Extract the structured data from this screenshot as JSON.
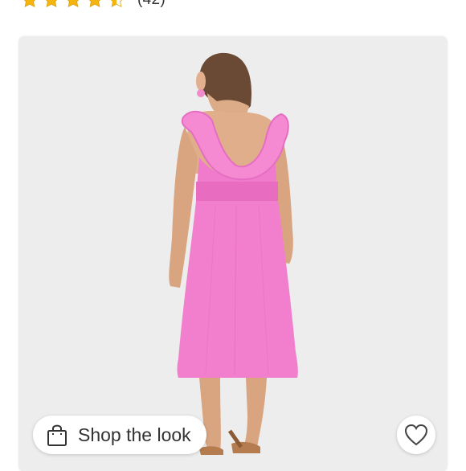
{
  "rating": {
    "stars": 4.5,
    "max_stars": 5,
    "count_text": "(42)",
    "star_color": "#f5b50f"
  },
  "product_image": {
    "subject": "woman in pink ruffle-strap midi dress, back view",
    "dress_color": "#f07acb",
    "background_color": "#ededed"
  },
  "actions": {
    "shop_the_look_label": "Shop the look",
    "shop_icon": "shopping-bag-icon",
    "favorite_icon": "heart-icon"
  }
}
